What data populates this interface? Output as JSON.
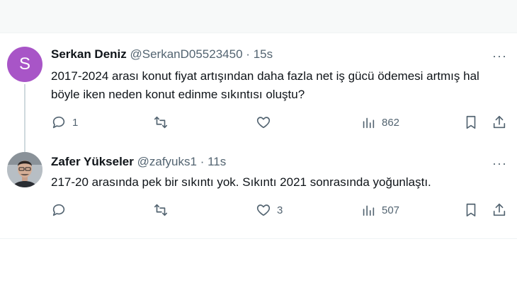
{
  "tweets": [
    {
      "avatar_letter": "S",
      "name": "Serkan Deniz",
      "handle": "@SerkanD05523450",
      "separator": "·",
      "time": "15s",
      "more": "···",
      "text": "2017-2024 arası konut fiyat artışından daha fazla net iş gücü ödemesi artmış hal böyle iken neden konut edinme sıkıntısı oluştu?",
      "replies": "1",
      "retweets": "",
      "likes": "",
      "views": "862"
    },
    {
      "name": "Zafer Yükseler",
      "handle": "@zafyuks1",
      "separator": "·",
      "time": "11s",
      "more": "···",
      "text": "217-20 arasında pek bir sıkıntı yok. Sıkıntı 2021 sonrasında yoğunlaştı.",
      "replies": "",
      "retweets": "",
      "likes": "3",
      "views": "507"
    }
  ],
  "colors": {
    "avatar_bg": "#a855c7",
    "secondary_text": "#536471",
    "primary_text": "#0f1419",
    "thread_line": "#cfd9de"
  },
  "icons": [
    "reply-icon",
    "retweet-icon",
    "like-icon",
    "views-icon",
    "bookmark-icon",
    "share-icon",
    "more-icon"
  ]
}
